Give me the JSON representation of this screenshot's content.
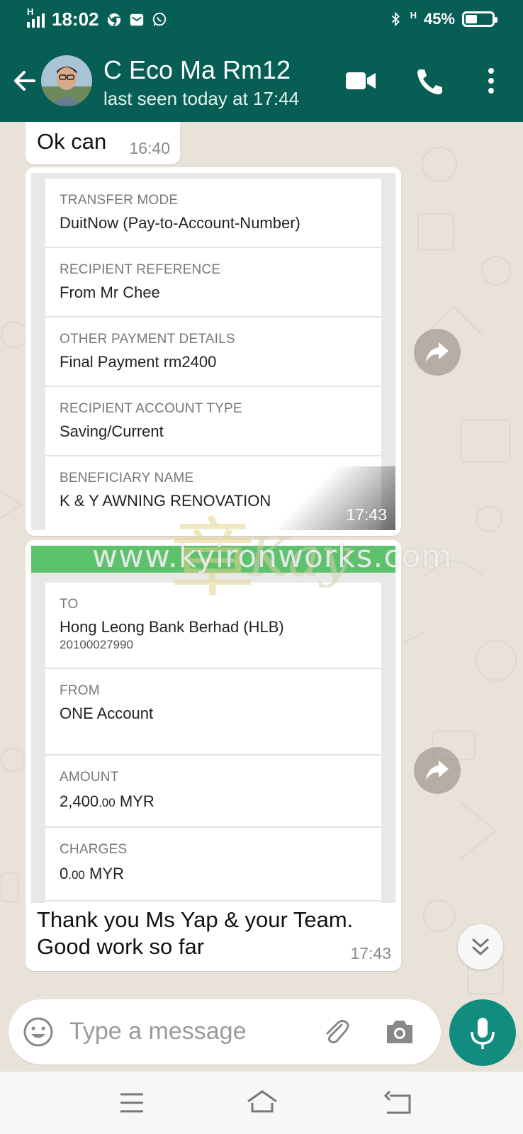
{
  "status_bar": {
    "time": "18:02",
    "network_label": "H",
    "battery_text": "45%",
    "battery_level": 0.45,
    "icons": [
      "signal-icon",
      "chrome-icon",
      "gmail-icon",
      "whatsapp-icon",
      "bluetooth-icon",
      "battery-icon"
    ]
  },
  "header": {
    "contact_name": "C Eco Ma Rm12",
    "last_seen": "last seen today at 17:44",
    "icons": [
      "back-arrow-icon",
      "video-call-icon",
      "phone-icon",
      "more-vert-icon"
    ]
  },
  "messages": {
    "m1": {
      "text": "Ok can",
      "time": "16:40"
    },
    "m2": {
      "time": "17:43",
      "fields": [
        {
          "label": "TRANSFER MODE",
          "value": "DuitNow (Pay-to-Account-Number)"
        },
        {
          "label": "RECIPIENT REFERENCE",
          "value": "From Mr Chee"
        },
        {
          "label": "OTHER PAYMENT DETAILS",
          "value": "Final Payment rm2400"
        },
        {
          "label": "RECIPIENT ACCOUNT TYPE",
          "value": "Saving/Current"
        },
        {
          "label": "BENEFICIARY NAME",
          "value": "K & Y AWNING RENOVATION"
        }
      ]
    },
    "m3": {
      "to_label": "TO",
      "to_value": "Hong Leong Bank Berhad (HLB)",
      "to_sub": "20100027990",
      "from_label": "FROM",
      "from_value": "ONE Account",
      "amount_label": "AMOUNT",
      "amount_int": "2,400",
      "amount_dec": ".00",
      "amount_cur": "MYR",
      "charges_label": "CHARGES",
      "charges_int": "0",
      "charges_dec": ".00",
      "charges_cur": "MYR",
      "caption_line1": "Thank you Ms Yap & your Team.",
      "caption_line2": "Good work so far",
      "time": "17:43"
    }
  },
  "watermark": {
    "text": "www.kyironworks.com"
  },
  "input": {
    "placeholder": "Type a message"
  },
  "colors": {
    "brand": "#075e54",
    "accent": "#128c7e",
    "receipt_green": "#5cc36c"
  }
}
